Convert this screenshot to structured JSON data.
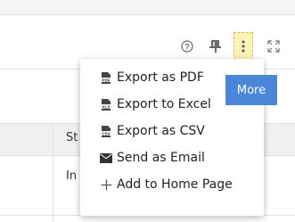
{
  "toolbar": {
    "help_icon": "help-circle-icon",
    "pin_icon": "pin-icon",
    "more_icon": "vertical-dots-icon",
    "expand_icon": "expand-icon"
  },
  "table": {
    "header_partial": "St",
    "cell_partial": "In"
  },
  "menu": {
    "items": [
      {
        "icon": "pdf-file-icon",
        "label": "Export as PDF"
      },
      {
        "icon": "xls-file-icon",
        "label": "Export to Excel"
      },
      {
        "icon": "csv-file-icon",
        "label": "Export as CSV"
      },
      {
        "icon": "envelope-icon",
        "label": "Send as Email"
      },
      {
        "icon": "plus-icon",
        "label": "Add to Home Page"
      }
    ]
  },
  "tooltip": {
    "text": "More"
  },
  "colors": {
    "tooltip_bg": "#4b86d8",
    "more_button_highlight": "#fcf3b8"
  }
}
